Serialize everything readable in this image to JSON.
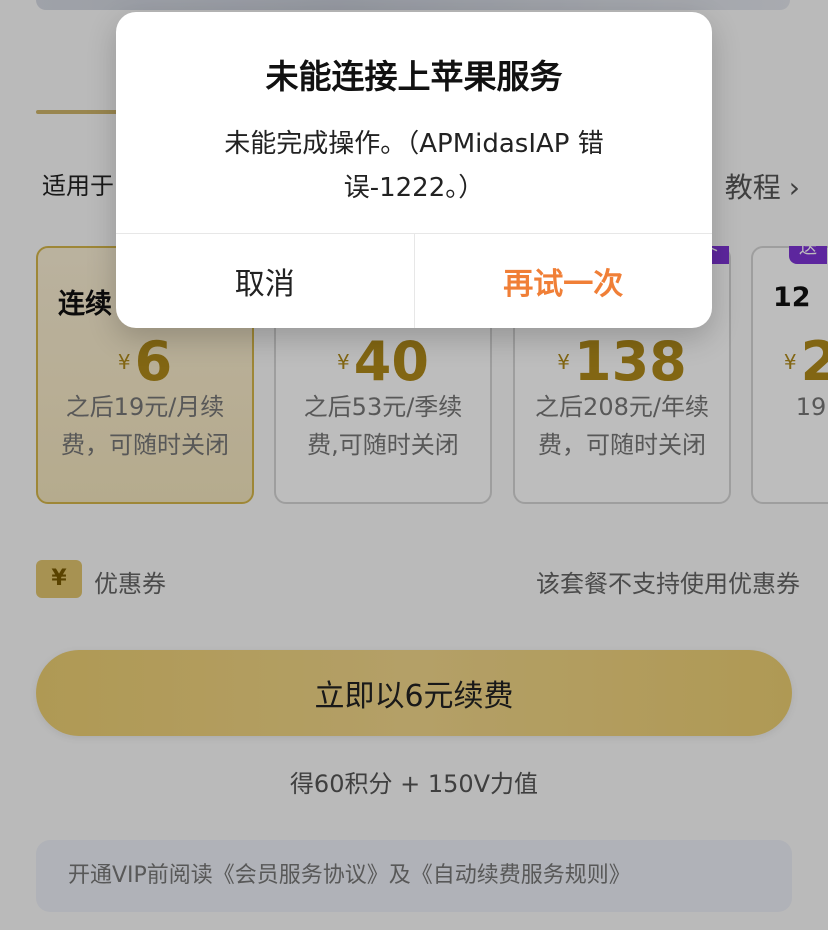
{
  "background": {
    "tab_label": "",
    "applicable_prefix": "适用于",
    "tutorial_link": "教程",
    "plans": [
      {
        "name": "连续",
        "tag": "",
        "price": "6",
        "yen": "¥",
        "description": "之后19元/月续费，可随时关闭"
      },
      {
        "name": "",
        "tag": "",
        "price": "40",
        "yen": "¥",
        "description": "之后53元/季续费,可随时关闭"
      },
      {
        "name": "",
        "tag": "卡",
        "price": "138",
        "yen": "¥",
        "description": "之后208元/年续费，可随时关闭"
      },
      {
        "name": "12",
        "tag": "送",
        "price": "2",
        "yen": "¥",
        "description": "19"
      }
    ],
    "coupon": {
      "icon": "¥",
      "label": "优惠券",
      "note": "该套餐不支持使用优惠券"
    },
    "renew_button": "立即以6元续费",
    "reward_text": "得60积分 + 150V力值",
    "agreement_text": "开通VIP前阅读《会员服务协议》及《自动续费服务规则》"
  },
  "dialog": {
    "title": "未能连接上苹果服务",
    "message": "未能完成操作。（APMidasIAP 错误-1222。）",
    "cancel_label": "取消",
    "retry_label": "再试一次"
  },
  "colors": {
    "accent_orange": "#f07f37",
    "gold": "#d6b74b",
    "purple_tag": "#7e34d6"
  }
}
